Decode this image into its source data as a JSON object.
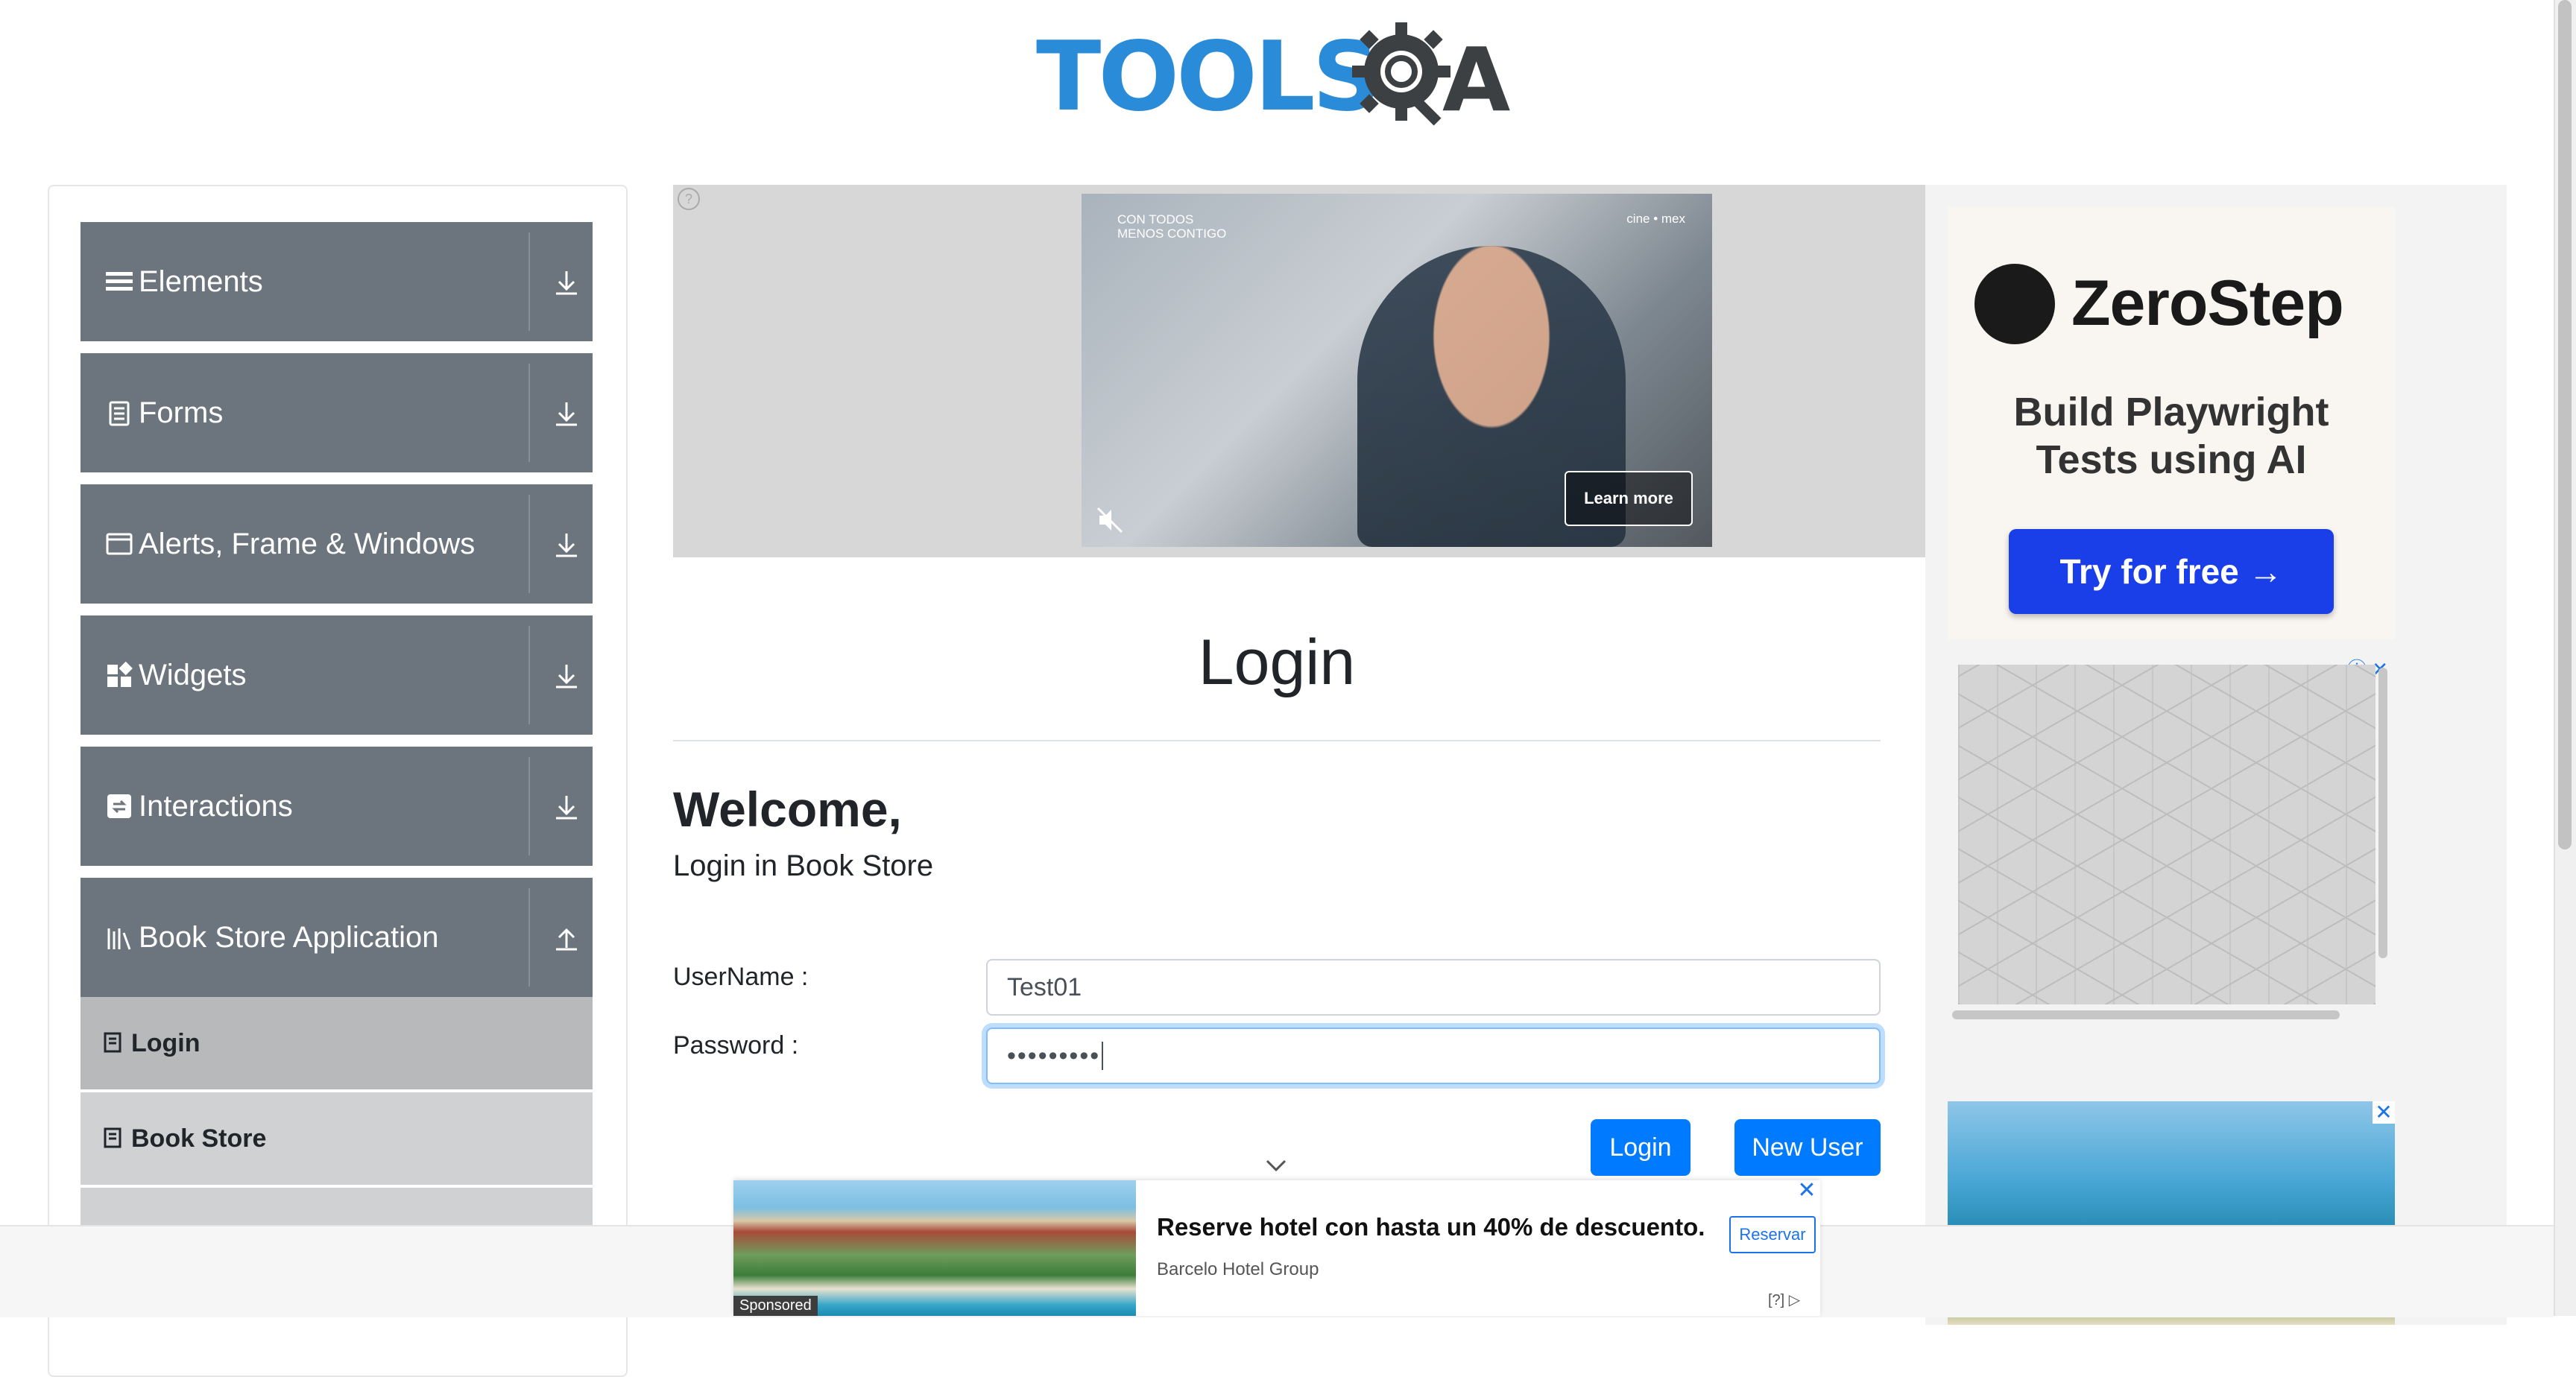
{
  "header": {
    "logo_text": "TOOLS",
    "logo_text_end": "A"
  },
  "sidebar": {
    "groups": [
      {
        "label": "Elements",
        "icon": "menu-icon",
        "arrow": "down"
      },
      {
        "label": "Forms",
        "icon": "document-icon",
        "arrow": "down"
      },
      {
        "label": "Alerts, Frame & Windows",
        "icon": "window-icon",
        "arrow": "down"
      },
      {
        "label": "Widgets",
        "icon": "widgets-icon",
        "arrow": "down"
      },
      {
        "label": "Interactions",
        "icon": "interactions-icon",
        "arrow": "down"
      },
      {
        "label": "Book Store Application",
        "icon": "books-icon",
        "arrow": "up"
      }
    ],
    "subitems": [
      {
        "label": "Login",
        "active": true
      },
      {
        "label": "Book Store",
        "active": false
      }
    ]
  },
  "top_ad": {
    "badge_line1": "CON TODOS",
    "badge_line2": "MENOS CONTIGO",
    "brand": "cine • mex",
    "learn_more": "Learn more"
  },
  "main": {
    "title": "Login",
    "welcome": "Welcome,",
    "subtitle": "Login in Book Store",
    "username_label": "UserName :",
    "username_value": "Test01",
    "password_label": "Password :",
    "password_value": "•••••••••",
    "login_button": "Login",
    "new_user_button": "New User"
  },
  "right_ad": {
    "brand": "ZeroStep",
    "tagline_line1": "Build Playwright",
    "tagline_line2": "Tests using AI",
    "cta": "Try for free →"
  },
  "sponsored": {
    "tag": "Sponsored",
    "headline": "Reserve hotel con hasta un 40% de descuento.",
    "advertiser": "Barcelo Hotel Group",
    "cta": "Reservar",
    "info": "[?]"
  },
  "colors": {
    "sidebar_group": "#6c757d",
    "sidebar_sub": "#cfd1d3",
    "primary": "#007bff",
    "zerostep_cta": "#1a3ee8",
    "logo_blue": "#2a8cd8"
  }
}
